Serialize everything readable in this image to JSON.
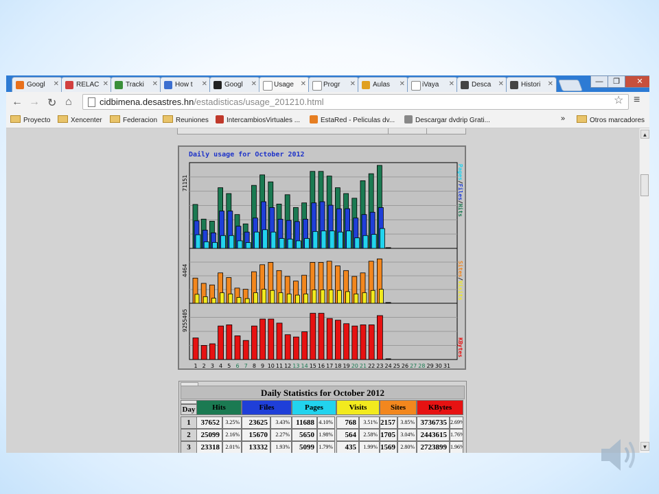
{
  "tabs": [
    {
      "label": "Googl",
      "icon": "analytics-icon",
      "color": "#e8711c"
    },
    {
      "label": "RELAC",
      "icon": "joomla-icon",
      "color": "#d13f3f"
    },
    {
      "label": "Tracki",
      "icon": "tracking-icon",
      "color": "#3a8f3a"
    },
    {
      "label": "How t",
      "icon": "google-plus-icon",
      "color": "#3b6fd0"
    },
    {
      "label": "Googl",
      "icon": "google-apps-icon",
      "color": "#222222"
    },
    {
      "label": "Usage",
      "icon": "page-icon",
      "color": "#ffffff",
      "active": true
    },
    {
      "label": "Progr",
      "icon": "page-icon",
      "color": "#ffffff"
    },
    {
      "label": "Aulas",
      "icon": "aulas-icon",
      "color": "#e0a020"
    },
    {
      "label": "iVaya",
      "icon": "page-icon",
      "color": "#ffffff"
    },
    {
      "label": "Desca",
      "icon": "download-icon",
      "color": "#444444"
    },
    {
      "label": "Histori",
      "icon": "history-icon",
      "color": "#444444"
    }
  ],
  "window_controls": {
    "minimize": "—",
    "restore": "❐",
    "close": "✕"
  },
  "address": {
    "host": "cidbimena.desastres.hn",
    "path": "/estadisticas/usage_201210.html"
  },
  "bookmarks": [
    {
      "label": "Proyecto",
      "icon": "folder-icon"
    },
    {
      "label": "Xencenter",
      "icon": "folder-icon"
    },
    {
      "label": "Federacion",
      "icon": "folder-icon"
    },
    {
      "label": "Reuniones",
      "icon": "folder-icon"
    },
    {
      "label": "IntercambiosVirtuales ...",
      "icon": "iv-icon"
    },
    {
      "label": "EstaRed - Peliculas dv...",
      "icon": "estared-icon"
    },
    {
      "label": "Descargar dvdrip Grati...",
      "icon": "skull-icon"
    }
  ],
  "bookmarks_more": "»",
  "other_bookmarks": "Otros marcadores",
  "chart": {
    "title": "Daily usage for October 2012",
    "top_max": "71151",
    "mid_max": "4464",
    "bot_max": "9255405",
    "legend_top": [
      "Pages",
      "/",
      "Files",
      "/",
      "Hits"
    ],
    "legend_mid": [
      "Sites",
      "/",
      "Visits"
    ],
    "legend_bot": "KBytes",
    "colors": {
      "hits": "#1b7a52",
      "files": "#1f3fd8",
      "pages": "#22d3ee",
      "sites": "#f2871e",
      "visits": "#f2ea1e",
      "kbytes": "#e61212"
    },
    "days": [
      "1",
      "2",
      "3",
      "4",
      "5",
      "6",
      "7",
      "8",
      "9",
      "10",
      "11",
      "12",
      "13",
      "14",
      "15",
      "16",
      "17",
      "18",
      "19",
      "20",
      "21",
      "22",
      "23",
      "24",
      "25",
      "26",
      "27",
      "28",
      "29",
      "30",
      "31"
    ],
    "weekend_days": [
      6,
      7,
      13,
      14,
      20,
      21,
      27,
      28
    ]
  },
  "chart_data": {
    "type": "bar",
    "title": "Daily usage for October 2012",
    "categories": [
      "1",
      "2",
      "3",
      "4",
      "5",
      "6",
      "7",
      "8",
      "9",
      "10",
      "11",
      "12",
      "13",
      "14",
      "15",
      "16",
      "17",
      "18",
      "19",
      "20",
      "21",
      "22",
      "23",
      "24",
      "25",
      "26",
      "27",
      "28",
      "29",
      "30",
      "31"
    ],
    "series": [
      {
        "name": "Hits",
        "values": [
          37652,
          25099,
          23318,
          52000,
          47000,
          29000,
          21000,
          54000,
          63000,
          57000,
          38000,
          46000,
          35000,
          39000,
          66000,
          66000,
          62000,
          52000,
          47000,
          43000,
          58000,
          64000,
          71151,
          0,
          0,
          0,
          0,
          0,
          0,
          0,
          0
        ]
      },
      {
        "name": "Files",
        "values": [
          23625,
          15670,
          13332,
          32000,
          32000,
          19000,
          14000,
          26000,
          40000,
          35000,
          25000,
          24000,
          23000,
          25000,
          39000,
          40000,
          37000,
          34000,
          34000,
          26000,
          29000,
          31000,
          35000,
          0,
          0,
          0,
          0,
          0,
          0,
          0,
          0
        ]
      },
      {
        "name": "Pages",
        "values": [
          11688,
          5650,
          5099,
          11000,
          11000,
          6500,
          5000,
          14000,
          16000,
          14000,
          8500,
          8000,
          6500,
          8500,
          14500,
          15000,
          15000,
          14000,
          15000,
          9000,
          11000,
          12000,
          17000,
          0,
          0,
          0,
          0,
          0,
          0,
          0,
          0
        ]
      },
      {
        "name": "Sites",
        "values": [
          2157,
          1705,
          1569,
          2600,
          2200,
          1300,
          1200,
          2700,
          3300,
          3500,
          2800,
          2300,
          1900,
          2400,
          3500,
          3500,
          3600,
          3200,
          2800,
          2300,
          2600,
          3600,
          3800,
          0,
          0,
          0,
          0,
          0,
          0,
          0,
          0
        ]
      },
      {
        "name": "Visits",
        "values": [
          768,
          564,
          435,
          900,
          800,
          500,
          400,
          900,
          1200,
          1100,
          900,
          800,
          700,
          800,
          1150,
          1150,
          1150,
          1100,
          1000,
          800,
          900,
          1100,
          1200,
          0,
          0,
          0,
          0,
          0,
          0,
          0,
          0
        ]
      },
      {
        "name": "KBytes",
        "values": [
          3736735,
          2443615,
          2723899,
          5800000,
          6000000,
          4100000,
          3300000,
          5800000,
          7000000,
          7000000,
          6300000,
          4300000,
          3900000,
          4800000,
          8000000,
          8000000,
          7100000,
          6800000,
          6200000,
          5800000,
          6000000,
          6000000,
          7600000,
          0,
          0,
          0,
          0,
          0,
          0,
          0,
          0
        ]
      }
    ],
    "ylim": {
      "hits": [
        0,
        71151
      ],
      "sites": [
        0,
        4464
      ],
      "kbytes": [
        0,
        9255405
      ]
    }
  },
  "stats_table": {
    "title": "Daily Statistics for October 2012",
    "headers": [
      "Day",
      "Hits",
      "Files",
      "Pages",
      "Visits",
      "Sites",
      "KBytes"
    ],
    "header_colors": [
      "#d3d3d3",
      "#1b7a52",
      "#1f3fd8",
      "#22d3ee",
      "#f2ea1e",
      "#f2871e",
      "#e61212"
    ],
    "rows": [
      [
        "1",
        "37652",
        "3.25%",
        "23625",
        "3.43%",
        "11688",
        "4.10%",
        "768",
        "3.51%",
        "2157",
        "3.85%",
        "3736735",
        "2.69%"
      ],
      [
        "2",
        "25099",
        "2.16%",
        "15670",
        "2.27%",
        "5650",
        "1.98%",
        "564",
        "2.58%",
        "1705",
        "3.04%",
        "2443615",
        "1.76%"
      ],
      [
        "3",
        "23318",
        "2.01%",
        "13332",
        "1.93%",
        "5099",
        "1.79%",
        "435",
        "1.99%",
        "1569",
        "2.80%",
        "2723899",
        "1.96%"
      ]
    ]
  },
  "speaker_icon": "speaker-icon"
}
